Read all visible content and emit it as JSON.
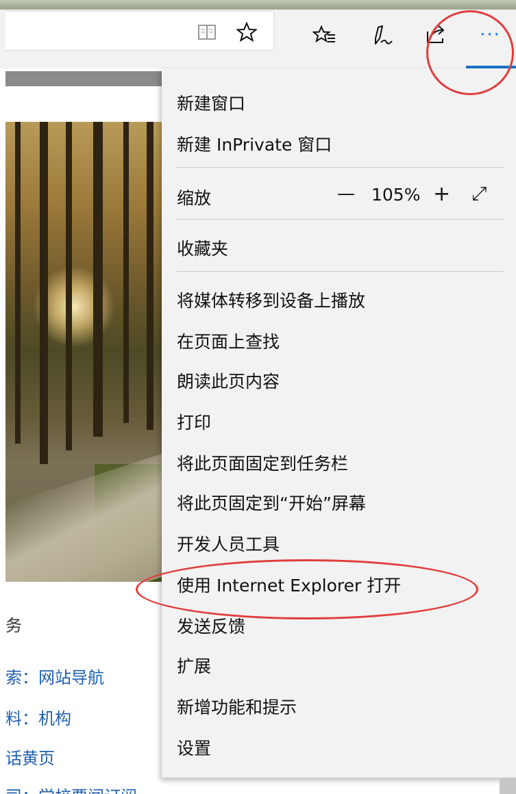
{
  "browser": {
    "toolbar": {
      "reading_view_icon": "book-icon",
      "favorite_icon": "star-icon",
      "favorites_hub_icon": "star-list-icon",
      "notes_icon": "pen-icon",
      "share_icon": "share-icon",
      "more_glyph": "···"
    }
  },
  "page": {
    "left_texts": [
      "务",
      "索：网站导航",
      "料：机构",
      "话黄页",
      "司：学校要闻订阅"
    ]
  },
  "menu": {
    "new_window": "新建窗口",
    "new_inprivate": "新建 InPrivate 窗口",
    "zoom_label": "缩放",
    "zoom_minus": "—",
    "zoom_value": "105%",
    "zoom_plus": "+",
    "zoom_fullscreen": "⤢",
    "favorites": "收藏夹",
    "cast_media": "将媒体转移到设备上播放",
    "find_on_page": "在页面上查找",
    "read_aloud": "朗读此页内容",
    "print": "打印",
    "pin_taskbar": "将此页面固定到任务栏",
    "pin_start": "将此页固定到“开始”屏幕",
    "dev_tools": "开发人员工具",
    "open_ie": "使用 Internet Explorer 打开",
    "feedback": "发送反馈",
    "extensions": "扩展",
    "whats_new": "新增功能和提示",
    "settings": "设置"
  },
  "colors": {
    "accent": "#0078d7",
    "annotation": "#e23b3b",
    "link": "#1f5fb0"
  }
}
